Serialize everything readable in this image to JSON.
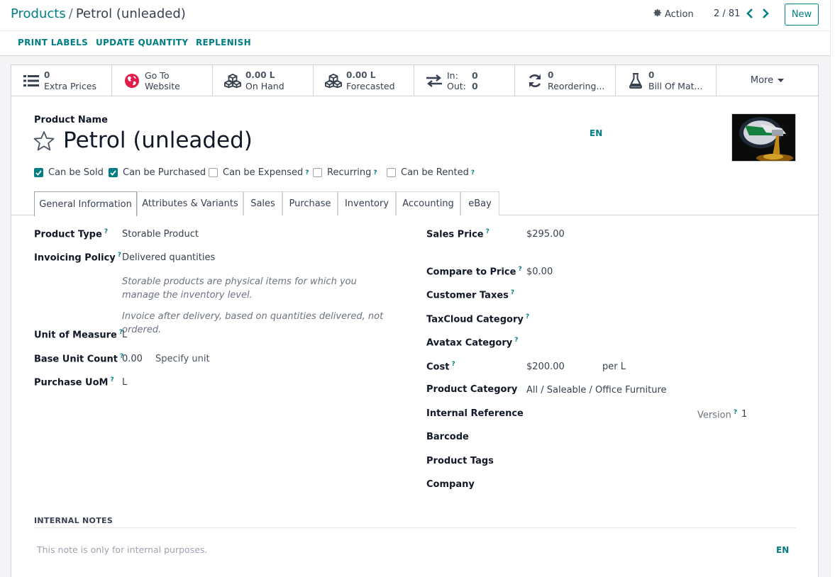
{
  "breadcrumb": {
    "parent": "Products",
    "separator": "/",
    "current": "Petrol (unleaded)"
  },
  "control": {
    "action_label": "Action",
    "pager": "2 / 81",
    "new_label": "New"
  },
  "action_bar": {
    "print_labels": "PRINT LABELS",
    "update_quantity": "UPDATE QUANTITY",
    "replenish": "REPLENISH"
  },
  "smart_buttons": {
    "extra_prices": {
      "value": "0",
      "label": "Extra Prices",
      "icon": "list-icon"
    },
    "website": {
      "line1": "Go To",
      "line2": "Website",
      "icon": "globe-icon"
    },
    "on_hand": {
      "value": "0.00 L",
      "label": "On Hand",
      "icon": "cubes-icon"
    },
    "forecasted": {
      "value": "0.00 L",
      "label": "Forecasted",
      "icon": "cubes-icon"
    },
    "in_out": {
      "in_label": "In:",
      "in_value": "0",
      "out_label": "Out:",
      "out_value": "0",
      "icon": "exchange-icon"
    },
    "reordering": {
      "value": "0",
      "label": "Reordering...",
      "icon": "refresh-icon"
    },
    "bom": {
      "value": "0",
      "label": "Bill Of Mat...",
      "icon": "flask-icon"
    },
    "more_label": "More"
  },
  "product": {
    "name_label": "Product Name",
    "name": "Petrol (unleaded)",
    "lang": "EN",
    "image_icon": "fuel-nozzle-image"
  },
  "checkboxes": {
    "can_be_sold": {
      "label": "Can be Sold",
      "checked": true
    },
    "can_be_purchased": {
      "label": "Can be Purchased",
      "checked": true
    },
    "can_be_expensed": {
      "label": "Can be Expensed",
      "checked": false
    },
    "recurring": {
      "label": "Recurring",
      "checked": false
    },
    "can_be_rented": {
      "label": "Can be Rented",
      "checked": false
    }
  },
  "tabs": [
    "General Information",
    "Attributes & Variants",
    "Sales",
    "Purchase",
    "Inventory",
    "Accounting",
    "eBay"
  ],
  "active_tab": "General Information",
  "left_fields": {
    "product_type": {
      "label": "Product Type",
      "value": "Storable Product"
    },
    "invoicing_policy": {
      "label": "Invoicing Policy",
      "value": "Delivered quantities"
    },
    "help1": "Storable products are physical items for which you manage the inventory level.",
    "help2": "Invoice after delivery, based on quantities delivered, not ordered.",
    "unit_of_measure": {
      "label": "Unit of Measure",
      "value": "L"
    },
    "base_unit_count": {
      "label": "Base Unit Count",
      "value": "0.00",
      "extra": "Specify unit"
    },
    "purchase_uom": {
      "label": "Purchase UoM",
      "value": "L"
    }
  },
  "right_fields": {
    "sales_price": {
      "label": "Sales Price",
      "value": "$295.00"
    },
    "compare_to_price": {
      "label": "Compare to Price",
      "value": "$0.00"
    },
    "customer_taxes": {
      "label": "Customer Taxes",
      "value": ""
    },
    "taxcloud_category": {
      "label": "TaxCloud Category",
      "value": ""
    },
    "avatax_category": {
      "label": "Avatax Category",
      "value": ""
    },
    "cost": {
      "label": "Cost",
      "value": "$200.00",
      "unit": "per L"
    },
    "product_category": {
      "label": "Product Category",
      "value": "All / Saleable / Office Furniture"
    },
    "internal_reference": {
      "label": "Internal Reference",
      "value": ""
    },
    "version": {
      "label": "Version",
      "value": "1"
    },
    "barcode": {
      "label": "Barcode",
      "value": ""
    },
    "product_tags": {
      "label": "Product Tags",
      "value": ""
    },
    "company": {
      "label": "Company",
      "value": ""
    }
  },
  "notes": {
    "title": "INTERNAL NOTES",
    "placeholder": "This note is only for internal purposes.",
    "lang": "EN"
  },
  "colors": {
    "accent": "#017e84",
    "text": "#374151",
    "border": "#d1d5db"
  }
}
